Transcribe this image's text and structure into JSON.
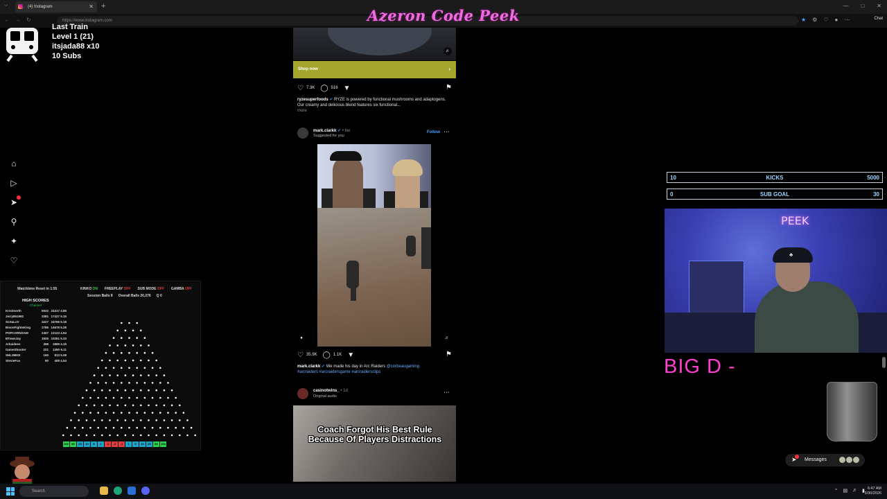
{
  "browser": {
    "tab_title": "(4) Instagram",
    "url": "https://www.instagram.com",
    "chat_label": "Chat"
  },
  "overlay": {
    "title": "Azeron Code Peek"
  },
  "train": {
    "name": "Last Train",
    "level": "Level 1  (21)",
    "user": "itsjada88 x10",
    "subs": "10 Subs"
  },
  "ig_nav": {
    "items": [
      "home-icon",
      "reels-icon",
      "messages-icon",
      "search-icon",
      "explore-icon",
      "notifications-icon"
    ]
  },
  "plinko": {
    "reset_text": "Watchtime Reset in 1:55",
    "modes": [
      {
        "name": "KINKO",
        "state": "ON"
      },
      {
        "name": "FREEPLAY",
        "state": "OFF"
      },
      {
        "name": "SUB MODE",
        "state": "OFF"
      },
      {
        "name": "GAMBA",
        "state": "OFF"
      }
    ],
    "session_balls_label": "Session Balls",
    "session_balls_value": "8",
    "overall_balls_label": "Overall Balls",
    "overall_balls_value": "20,276",
    "q_label": "Q",
    "q_value": "0",
    "high_scores_title": "HIGH SCORES",
    "high_scores_sub": "Channel",
    "scores": [
      {
        "name": "Kristinerth",
        "a": "5022",
        "b": "24417",
        "c": "4.86"
      },
      {
        "name": "Jerry851992",
        "a": "3381",
        "b": "17427",
        "c": "5.15"
      },
      {
        "name": "SoSaLsV",
        "a": "3227",
        "b": "16766",
        "c": "5.18"
      },
      {
        "name": "BisonFightsKing",
        "a": "2785",
        "b": "14678",
        "c": "5.28"
      },
      {
        "name": "POPCORNSAM",
        "a": "2457",
        "b": "12123",
        "c": "4.94"
      },
      {
        "name": "BTownJay",
        "a": "1925",
        "b": "10251",
        "c": "5.33"
      },
      {
        "name": "Arkaidees",
        "a": "458",
        "b": "1869",
        "c": "4.15"
      },
      {
        "name": "GameShooter",
        "a": "221",
        "b": "1350",
        "c": "6.11"
      },
      {
        "name": "SHL3MKE",
        "a": "160",
        "b": "813",
        "c": "5.08"
      },
      {
        "name": "StevieFox",
        "a": "90",
        "b": "409",
        "c": "4.54"
      }
    ],
    "buckets": [
      "100",
      "50",
      "25",
      "10",
      "5",
      "1",
      "-1",
      "-2",
      "-1",
      "1",
      "5",
      "10",
      "25",
      "50",
      "100"
    ],
    "bucket_colors": [
      "#2bd24f",
      "#2bd24f",
      "#1aa5c9",
      "#1aa5c9",
      "#1aa5c9",
      "#1aa5c9",
      "#e23d3d",
      "#e23d3d",
      "#e23d3d",
      "#1aa5c9",
      "#1aa5c9",
      "#1aa5c9",
      "#1aa5c9",
      "#2bd24f",
      "#2bd24f"
    ]
  },
  "feed": {
    "post1": {
      "shop_label": "Shop now",
      "likes": "7.3K",
      "comments": "516",
      "caption_user": "ryzesuperfoods",
      "caption_text": " RYZE is powered by functional mushrooms and adaptogens. Our creamy and delicious blend features six functional...",
      "more": "more"
    },
    "post2": {
      "user": "mark.clarkk",
      "time": "6w",
      "subtitle": "Suggested for you",
      "follow": "Follow",
      "likes": "35.9K",
      "comments": "1.1K",
      "caption_user": "mark.clarkk",
      "caption_text": " We made his day in Arc Raiders",
      "caption_mention": "@corbeaugaming",
      "caption_tags": "#arcraiders #arcraidersgame #arcraidersclips"
    },
    "post3": {
      "user": "casinotwins_",
      "time": "1d",
      "subtitle": "Original audio",
      "overlay_text": "Coach Forgot His Best Rule Because Of Players Distractions"
    }
  },
  "stream": {
    "kicks_left": "10",
    "kicks_label": "KICKS",
    "kicks_right": "5000",
    "sub_left": "0",
    "sub_label": "SUB GOAL",
    "sub_right": "30",
    "webcam_text": "PEEK",
    "big_text": "BIG D -"
  },
  "messages": {
    "label": "Messages"
  },
  "taskbar": {
    "search_placeholder": "Search",
    "time": "6:47 AM",
    "date": "3/30/2026"
  }
}
